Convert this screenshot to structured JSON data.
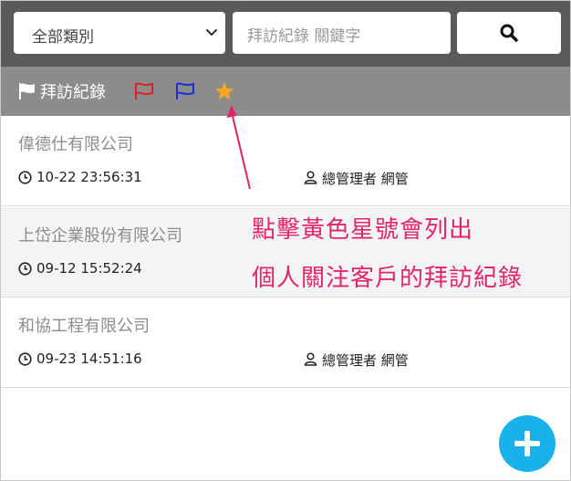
{
  "filter": {
    "category_selected": "全部類別",
    "search_placeholder": "拜訪紀錄 關鍵字"
  },
  "toolbar": {
    "title": "拜訪紀錄"
  },
  "records": [
    {
      "company": "偉德仕有限公司",
      "time": "10-22 23:56:31",
      "user": "總管理者 網管"
    },
    {
      "company": "上岱企業股份有限公司",
      "time": "09-12 15:52:24",
      "user": ""
    },
    {
      "company": "和協工程有限公司",
      "time": "09-23 14:51:16",
      "user": "總管理者 網管"
    }
  ],
  "annotation": {
    "line1": "點擊黃色星號會列出",
    "line2": "個人關注客戶的拜訪紀錄"
  },
  "colors": {
    "topbar": "#5a5a5a",
    "toolbar": "#8c8c8c",
    "flag_red": "#e02020",
    "flag_blue": "#1a2fd6",
    "star": "#f5a623",
    "annotation": "#e0246d",
    "fab": "#19b1ea"
  },
  "icons": [
    "chevron-down-icon",
    "search-icon",
    "flag-icon",
    "star-icon",
    "clock-icon",
    "user-icon",
    "plus-icon"
  ]
}
